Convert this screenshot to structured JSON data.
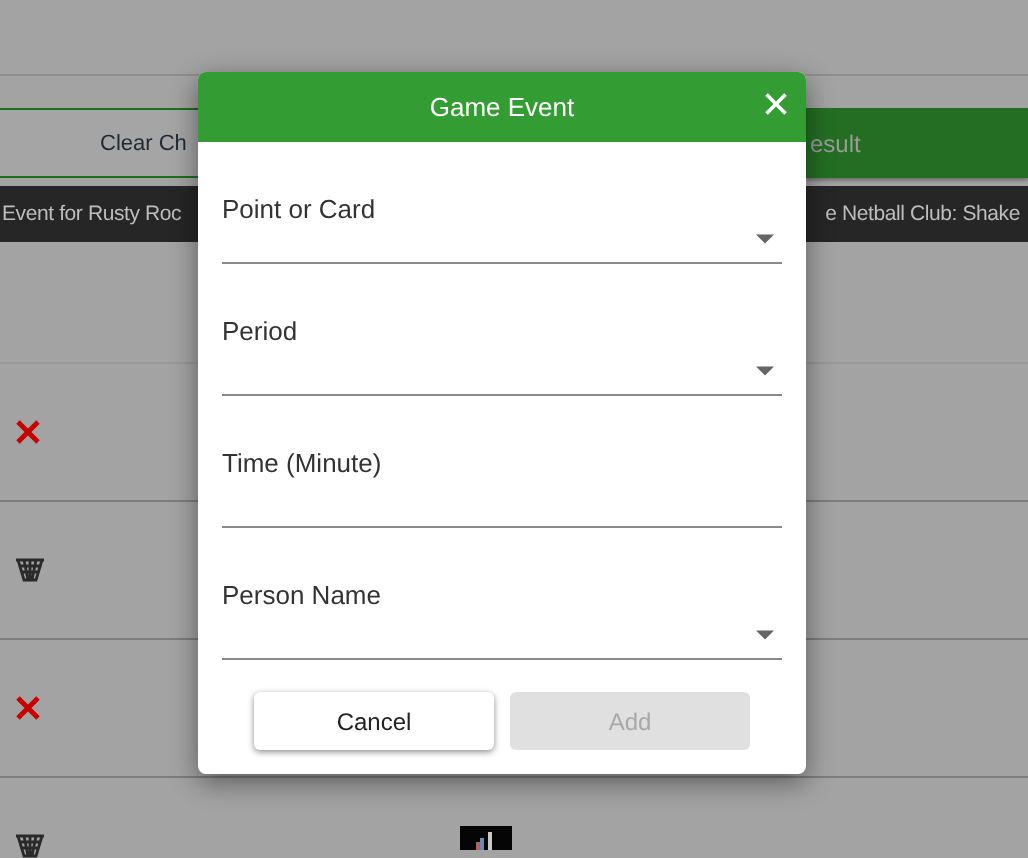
{
  "page": {
    "clear_button": "Clear Ch",
    "result_button": "esult",
    "banner_left": "Event for Rusty Roc",
    "banner_right": "e Netball Club: Shake",
    "rows": [
      {
        "kind": "cross"
      },
      {
        "kind": "basket"
      },
      {
        "kind": "cross"
      },
      {
        "kind": "basket"
      }
    ]
  },
  "dialog": {
    "title": "Game Event",
    "close": "×",
    "fields": [
      {
        "label": "Point or Card",
        "kind": "select"
      },
      {
        "label": "Period",
        "kind": "select"
      },
      {
        "label": "Time (Minute)",
        "kind": "text"
      },
      {
        "label": "Person Name",
        "kind": "select"
      }
    ],
    "buttons": [
      {
        "label": "Cancel",
        "disabled": false
      },
      {
        "label": "Add",
        "disabled": true
      }
    ]
  }
}
